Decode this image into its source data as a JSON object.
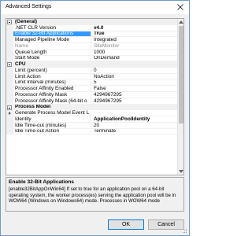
{
  "window": {
    "title": "Advanced Settings"
  },
  "grid": {
    "rows": [
      {
        "kind": "cat",
        "label": "(General)",
        "state": "expanded"
      },
      {
        "kind": "prop",
        "name": ".NET CLR Version",
        "value": "v4.0",
        "bold": true
      },
      {
        "kind": "prop",
        "name": "Enable 32-Bit Applications",
        "value": "True",
        "bold": true,
        "selected": true
      },
      {
        "kind": "prop",
        "name": "Managed Pipeline Mode",
        "value": "Integrated"
      },
      {
        "kind": "prop",
        "name": "Name",
        "value": "SiteMonitor",
        "disabled": true
      },
      {
        "kind": "prop",
        "name": "Queue Length",
        "value": "1000"
      },
      {
        "kind": "prop",
        "name": "Start Mode",
        "value": "OnDemand"
      },
      {
        "kind": "cat",
        "label": "CPU",
        "state": "expanded"
      },
      {
        "kind": "prop",
        "name": "Limit (percent)",
        "value": "0"
      },
      {
        "kind": "prop",
        "name": "Limit Action",
        "value": "NoAction"
      },
      {
        "kind": "prop",
        "name": "Limit Interval (minutes)",
        "value": "5"
      },
      {
        "kind": "prop",
        "name": "Processor Affinity Enabled",
        "value": "False"
      },
      {
        "kind": "prop",
        "name": "Processor Affinity Mask",
        "value": "4294967295"
      },
      {
        "kind": "prop",
        "name": "Processor Affinity Mask (64-bit o",
        "value": "4294967295"
      },
      {
        "kind": "cat",
        "label": "Process Model",
        "state": "expanded"
      },
      {
        "kind": "prop",
        "name": "Generate Process Model Event L",
        "value": "",
        "expandable": true
      },
      {
        "kind": "prop",
        "name": "Identity",
        "value": "ApplicationPoolIdentity",
        "bold": true
      },
      {
        "kind": "prop",
        "name": "Idle Time-out (minutes)",
        "value": "20"
      },
      {
        "kind": "prop",
        "name": "Idle Time-out Action",
        "value": "Terminate"
      }
    ]
  },
  "description": {
    "title": "Enable 32-Bit Applications",
    "body": "[enable32BitAppOnWin64] If set to true for an application pool on a 64-bit operating system, the worker process(es) serving the application pool will be in WOW64 (Windows on Windows64) mode. Processes in WOW64 mode"
  },
  "buttons": {
    "ok": "OK",
    "cancel": "Cancel"
  },
  "icons": {
    "close": "close-icon",
    "collapse": "collapse-icon",
    "expand": "expand-arrow-icon",
    "scroll_up": "scroll-up-icon",
    "scroll_down": "scroll-down-icon",
    "resize": "resize-grip-icon"
  },
  "colors": {
    "selection": "#3399ff",
    "category_bg": "#f0f0f0",
    "ok_border": "#0078d7"
  }
}
